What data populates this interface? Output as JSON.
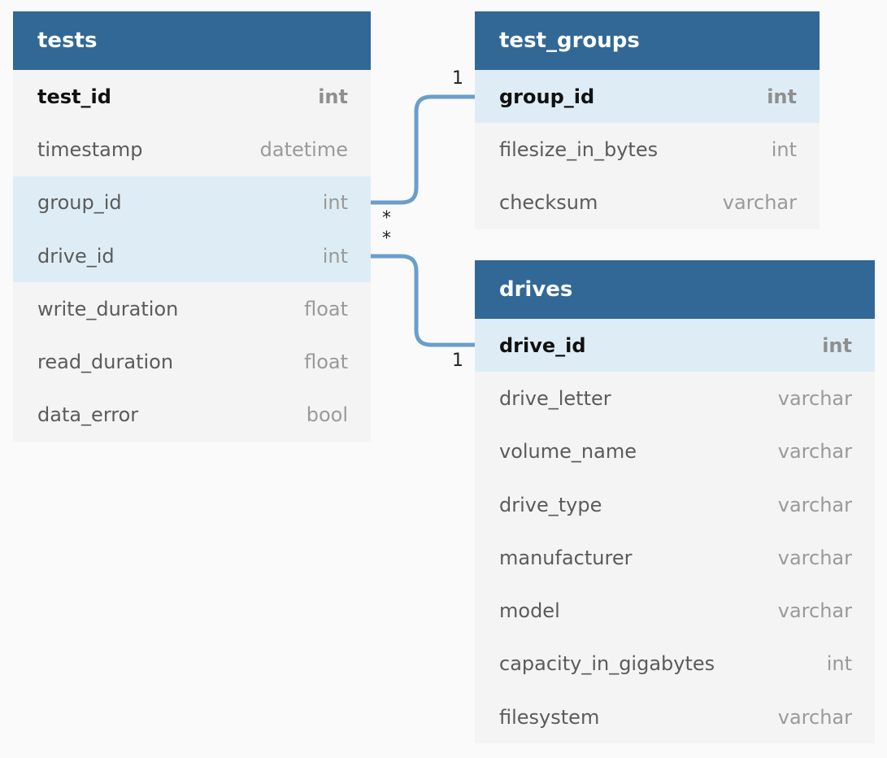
{
  "tables": {
    "tests": {
      "name": "tests",
      "columns": [
        {
          "name": "test_id",
          "type": "int"
        },
        {
          "name": "timestamp",
          "type": "datetime"
        },
        {
          "name": "group_id",
          "type": "int"
        },
        {
          "name": "drive_id",
          "type": "int"
        },
        {
          "name": "write_duration",
          "type": "float"
        },
        {
          "name": "read_duration",
          "type": "float"
        },
        {
          "name": "data_error",
          "type": "bool"
        }
      ]
    },
    "test_groups": {
      "name": "test_groups",
      "columns": [
        {
          "name": "group_id",
          "type": "int"
        },
        {
          "name": "filesize_in_bytes",
          "type": "int"
        },
        {
          "name": "checksum",
          "type": "varchar"
        }
      ]
    },
    "drives": {
      "name": "drives",
      "columns": [
        {
          "name": "drive_id",
          "type": "int"
        },
        {
          "name": "drive_letter",
          "type": "varchar"
        },
        {
          "name": "volume_name",
          "type": "varchar"
        },
        {
          "name": "drive_type",
          "type": "varchar"
        },
        {
          "name": "manufacturer",
          "type": "varchar"
        },
        {
          "name": "model",
          "type": "varchar"
        },
        {
          "name": "capacity_in_gigabytes",
          "type": "int"
        },
        {
          "name": "filesystem",
          "type": "varchar"
        }
      ]
    }
  },
  "relations": {
    "group": {
      "many": "*",
      "one": "1"
    },
    "drive": {
      "many": "*",
      "one": "1"
    }
  },
  "colors": {
    "header": "#316896",
    "highlight": "#deedf5",
    "connector": "#6a9ecb",
    "table_body": "#f4f4f4",
    "background": "#fafafa"
  }
}
